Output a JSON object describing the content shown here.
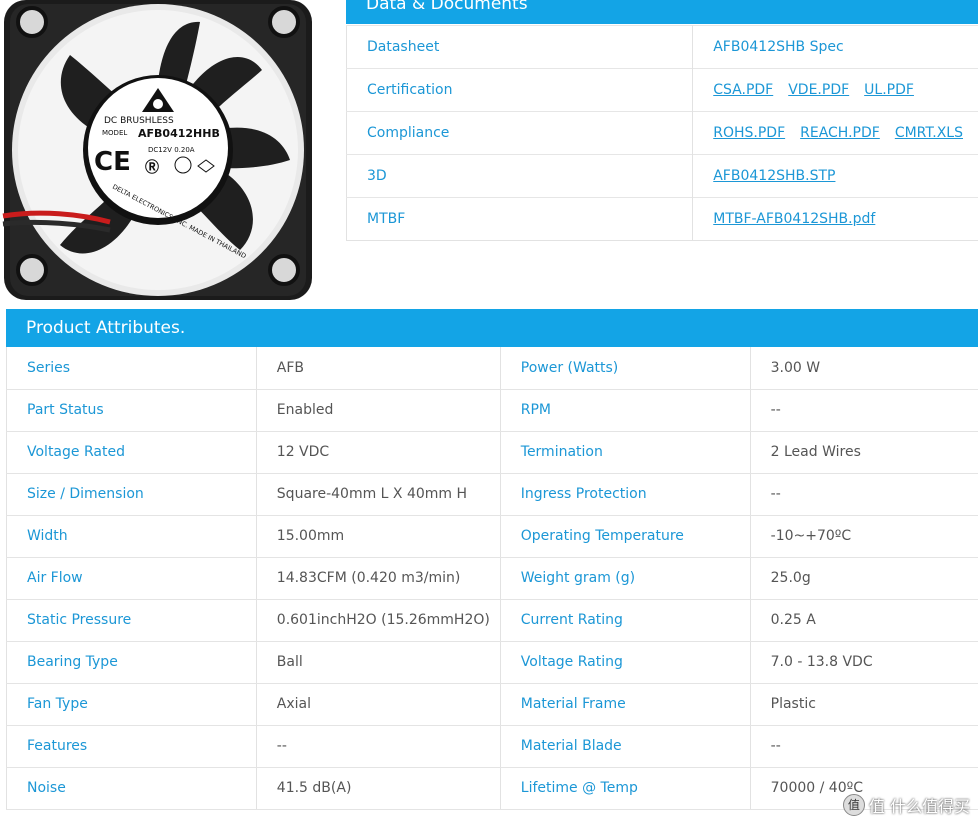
{
  "image": {
    "label_top": "DC  BRUSHLESS",
    "model_label": "MODEL",
    "model": "AFB0412HHB",
    "rating": "DC12V   0.20A",
    "ring_text": "DELTA ELECTRONICS, INC. MADE IN THAILAND",
    "colors": {
      "frame": "#1c1c1c",
      "blade": "#222222",
      "label": "#ffffff",
      "wire_red": "#d42020"
    }
  },
  "docs": {
    "title": "Data & Documents",
    "rows": [
      {
        "label": "Datasheet",
        "items": [
          {
            "text": "AFB0412SHB Spec",
            "link": false
          }
        ]
      },
      {
        "label": "Certification",
        "items": [
          {
            "text": "CSA.PDF",
            "link": true
          },
          {
            "text": "VDE.PDF",
            "link": true
          },
          {
            "text": "UL.PDF",
            "link": true
          }
        ]
      },
      {
        "label": "Compliance",
        "items": [
          {
            "text": "ROHS.PDF",
            "link": true
          },
          {
            "text": "REACH.PDF",
            "link": true
          },
          {
            "text": "CMRT.XLS",
            "link": true
          }
        ]
      },
      {
        "label": "3D",
        "items": [
          {
            "text": "AFB0412SHB.STP",
            "link": true
          }
        ]
      },
      {
        "label": "MTBF",
        "items": [
          {
            "text": "MTBF-AFB0412SHB.pdf",
            "link": true
          }
        ]
      }
    ]
  },
  "attributes": {
    "title": "Product Attributes.",
    "rows": [
      [
        "Series",
        "AFB",
        "Power (Watts)",
        "3.00 W"
      ],
      [
        "Part Status",
        "Enabled",
        "RPM",
        "--"
      ],
      [
        "Voltage Rated",
        "12 VDC",
        "Termination",
        "2 Lead Wires"
      ],
      [
        "Size / Dimension",
        "Square-40mm L X 40mm H",
        "Ingress Protection",
        "--"
      ],
      [
        "Width",
        "15.00mm",
        "Operating Temperature",
        "-10~+70ºC"
      ],
      [
        "Air Flow",
        "14.83CFM (0.420 m3/min)",
        "Weight gram (g)",
        "25.0g"
      ],
      [
        "Static Pressure",
        "0.601inchH2O (15.26mmH2O)",
        "Current Rating",
        "0.25 A"
      ],
      [
        "Bearing Type",
        "Ball",
        "Voltage Rating",
        "7.0 - 13.8 VDC"
      ],
      [
        "Fan Type",
        "Axial",
        "Material Frame",
        "Plastic"
      ],
      [
        "Features",
        "--",
        "Material Blade",
        "--"
      ],
      [
        "Noise",
        "41.5 dB(A)",
        "Lifetime @ Temp",
        "70000 / 40ºC"
      ]
    ]
  },
  "watermark": {
    "text": "值 什么值得买",
    "icon": "zhi-badge-icon"
  },
  "colors": {
    "accent": "#13a4e6",
    "link": "#1c97d6",
    "value_text": "#555555"
  }
}
